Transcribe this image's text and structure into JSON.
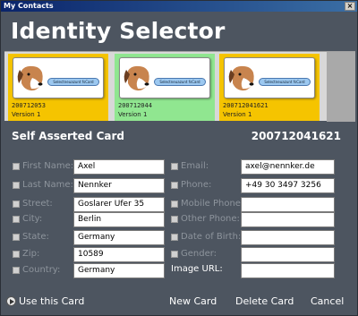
{
  "window": {
    "title": "My Contacts",
    "close_glyph": "×"
  },
  "header": {
    "title": "Identity Selector"
  },
  "cards": [
    {
      "id": "200712053",
      "version": "Version 1",
      "badge": "Selectneuazunt fsCard",
      "bg": "#f5c400",
      "selected": false
    },
    {
      "id": "200712044",
      "version": "Version 1",
      "badge": "Selectneuazunt fsCard",
      "bg": "#90e690",
      "selected": true
    },
    {
      "id": "200712041621",
      "version": "Version 1",
      "badge": "Selectneuazunt fsCard",
      "bg": "#f5c400",
      "selected": false
    }
  ],
  "card_details": {
    "title": "Self Asserted Card",
    "number": "200712041621"
  },
  "fields_left": [
    {
      "label": "First Name:",
      "value": "Axel"
    },
    {
      "label": "Last Name:",
      "value": "Nennker"
    },
    {
      "label": "Street:",
      "value": "Goslarer Ufer 35"
    },
    {
      "label": "City:",
      "value": "Berlin"
    },
    {
      "label": "State:",
      "value": "Germany"
    },
    {
      "label": "Zip:",
      "value": "10589"
    },
    {
      "label": "Country:",
      "value": "Germany"
    }
  ],
  "fields_right": [
    {
      "label": "Email:",
      "value": "axel@nennker.de"
    },
    {
      "label": "Phone:",
      "value": "+49 30 3497 3256"
    },
    {
      "label": "Mobile Phone:",
      "value": ""
    },
    {
      "label": "Other Phone:",
      "value": ""
    },
    {
      "label": "Date of Birth:",
      "value": ""
    },
    {
      "label": "Gender:",
      "value": ""
    }
  ],
  "image_url": {
    "label": "Image URL:",
    "value": ""
  },
  "footer": {
    "use_card": "Use this Card",
    "new_card": "New Card",
    "delete_card": "Delete Card",
    "cancel": "Cancel"
  },
  "colors": {
    "panel": "#4d5560",
    "label_disabled": "#8d949c",
    "selected_card": "#90e690",
    "card_yellow": "#f5c400"
  }
}
